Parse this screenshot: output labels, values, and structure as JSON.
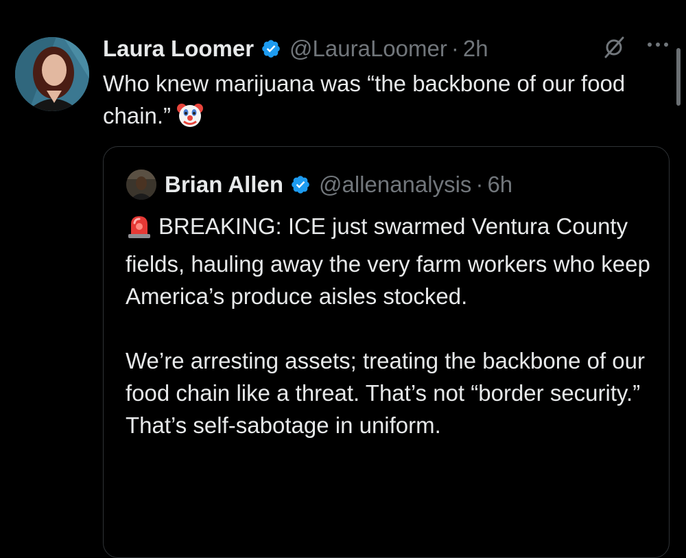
{
  "tweet": {
    "display_name": "Laura Loomer",
    "handle": "@LauraLoomer",
    "separator": "·",
    "time": "2h",
    "text": "Who knew marijuana was “the backbone of our food chain.”",
    "emoji_icon": "clown-face-icon"
  },
  "quoted_tweet": {
    "display_name": "Brian Allen",
    "handle": "@allenanalysis",
    "separator": "·",
    "time": "6h",
    "lead_icon": "police-siren-icon",
    "paragraph_1": "BREAKING: ICE just swarmed Ventura County fields, hauling away the very farm workers who keep America’s produce aisles stocked.",
    "paragraph_2": "We’re arresting assets; treating the backbone of our food chain like a threat. That’s not “border security.” That’s self-sabotage in uniform."
  },
  "icons": {
    "verified": "verified-badge-icon",
    "grok": "grok-icon",
    "more": "more-options-icon"
  },
  "colors": {
    "background": "#000000",
    "text_primary": "#e7e9ea",
    "text_secondary": "#71767b",
    "verified_blue": "#1d9bf0",
    "border": "#2f3336"
  }
}
